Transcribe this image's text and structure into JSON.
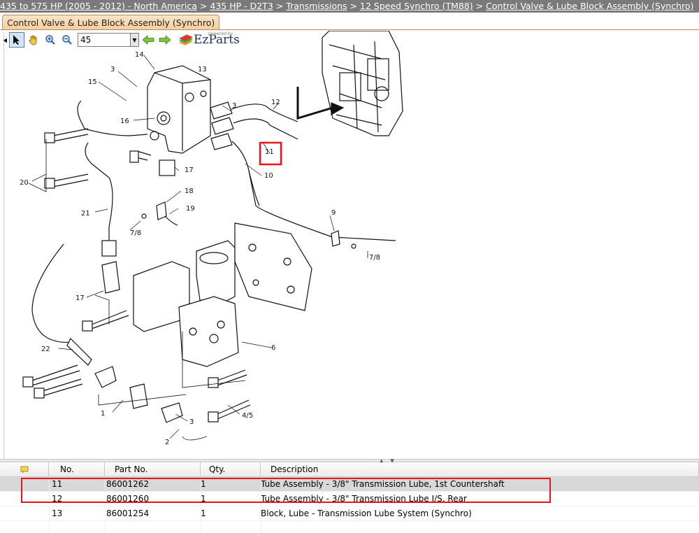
{
  "breadcrumb": {
    "items": [
      {
        "label": "435 to 575 HP (2005 - 2012) - North America"
      },
      {
        "label": "435 HP - D2T3"
      },
      {
        "label": "Transmissions"
      },
      {
        "label": "12 Speed Synchro (TM88)"
      },
      {
        "label": "Control Valve & Lube Block Assembly (Synchro)"
      }
    ],
    "separator": ">"
  },
  "tab": {
    "label": "Control Valve & Lube Block Assembly (Synchro)"
  },
  "toolbar": {
    "zoom_value": "45",
    "brand_small": "powered by",
    "brand_name": "EzParts",
    "icons": [
      "pointer-icon",
      "hand-icon",
      "zoom-in-icon",
      "zoom-out-icon",
      "back-arrow-icon",
      "forward-arrow-icon"
    ]
  },
  "diagram": {
    "callouts": [
      "14",
      "13",
      "3",
      "15",
      "16",
      "3",
      "12",
      "11",
      "10",
      "20",
      "17",
      "18",
      "19",
      "21",
      "7/8",
      "9",
      "7/8",
      "17",
      "22",
      "6",
      "1",
      "3",
      "4/5",
      "2"
    ],
    "highlight_color": "#e8141c"
  },
  "table": {
    "columns": [
      "No.",
      "Part No.",
      "Qty.",
      "Description"
    ],
    "rows": [
      {
        "no": "11",
        "part": "86001262",
        "qty": "1",
        "desc": "Tube Assembly - 3/8\" Transmission Lube, 1st Countershaft",
        "selected": true
      },
      {
        "no": "12",
        "part": "86001260",
        "qty": "1",
        "desc": "Tube Assembly - 3/8\" Transmission Lube I/S, Rear",
        "selected": false
      },
      {
        "no": "13",
        "part": "86001254",
        "qty": "1",
        "desc": "Block, Lube - Transmission Lube System (Synchro)",
        "selected": false
      }
    ]
  }
}
